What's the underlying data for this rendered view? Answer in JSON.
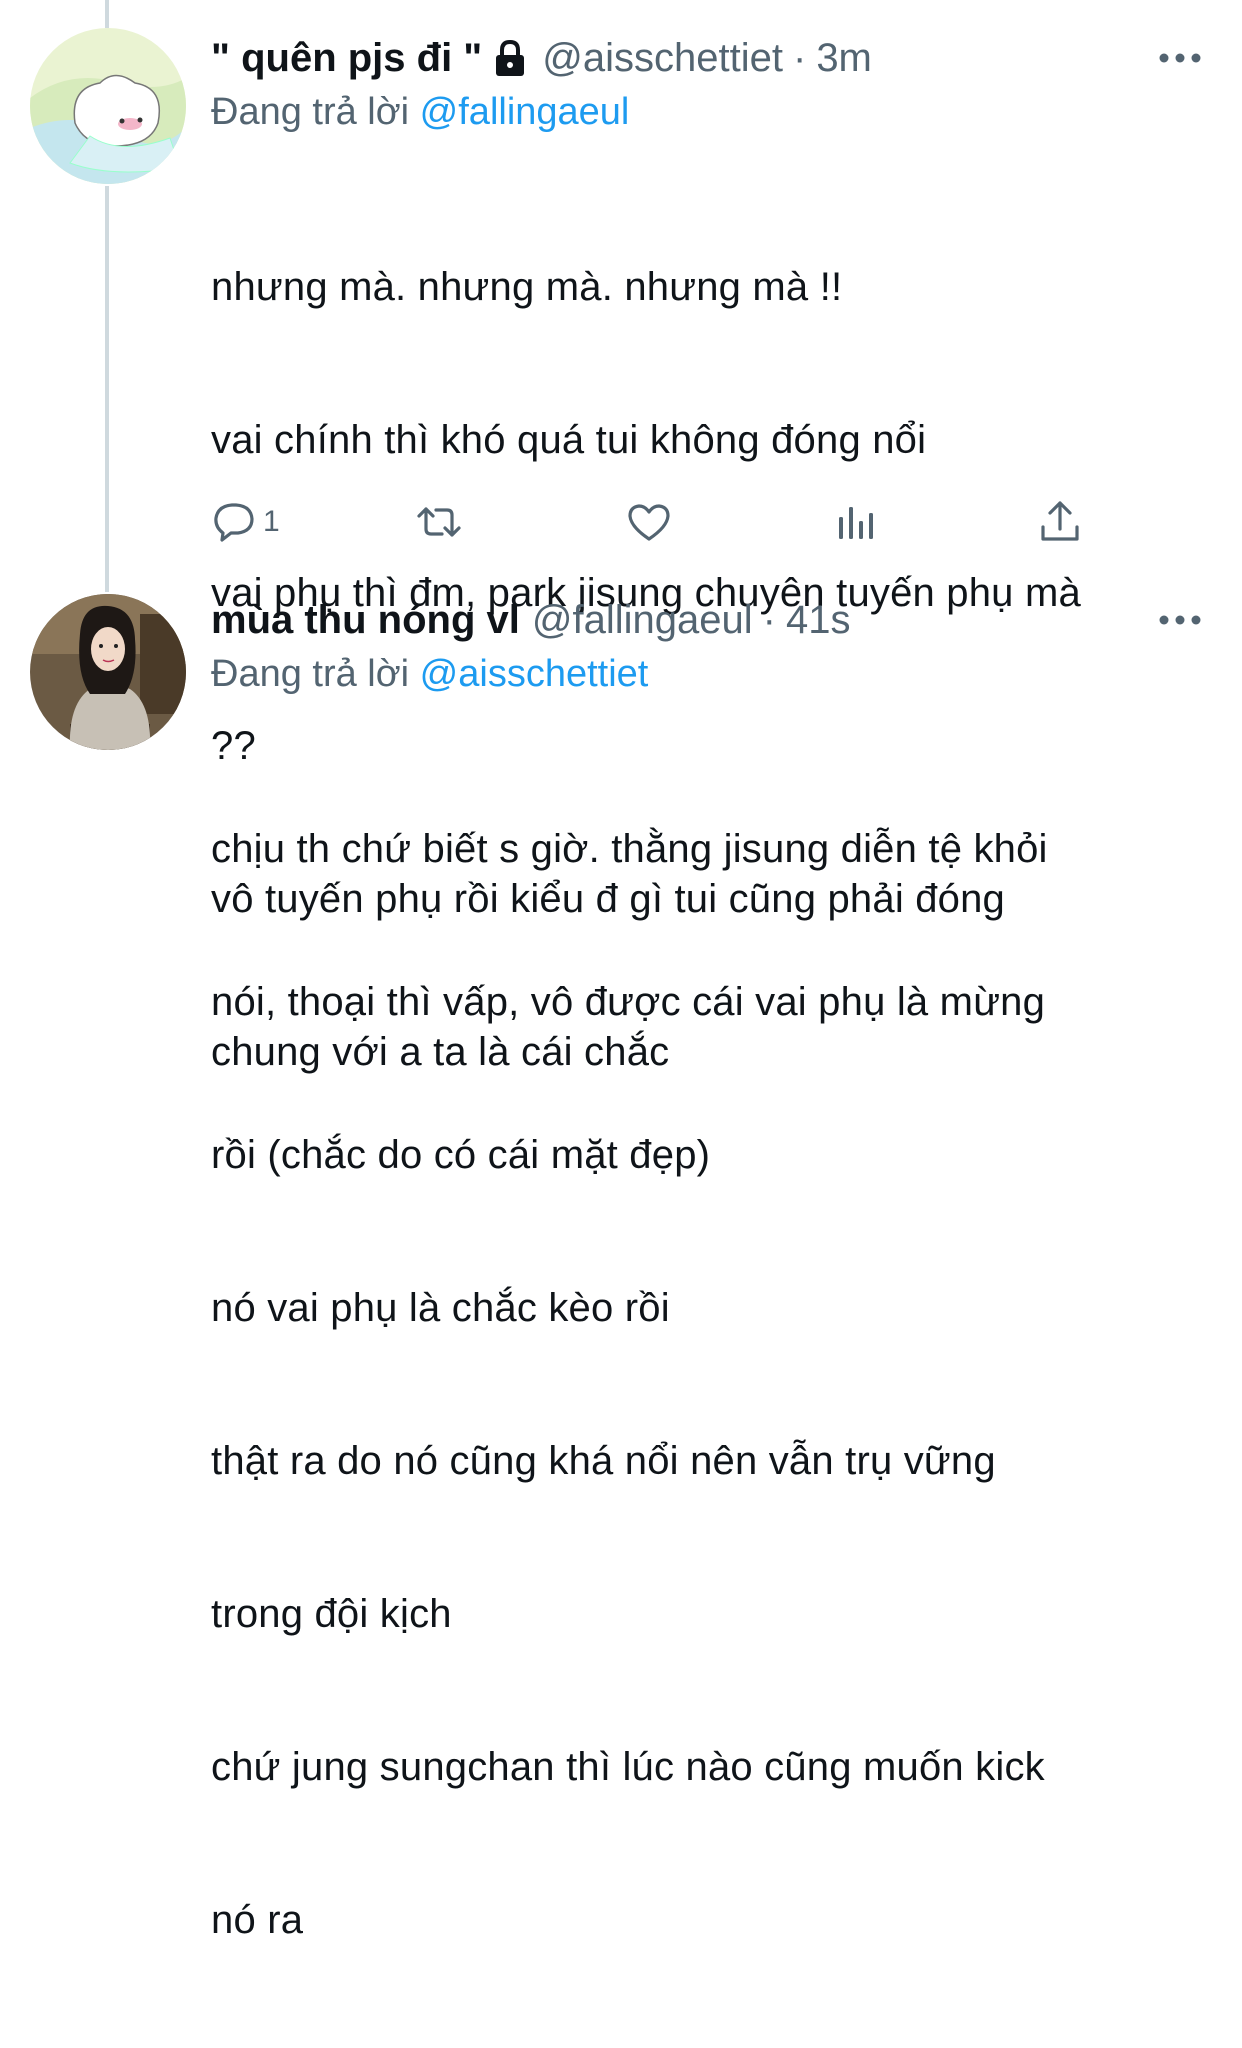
{
  "tweets": [
    {
      "display_name": "\" quên pjs đi \"",
      "handle": "@aisschettiet",
      "separator": "·",
      "time": "3m",
      "replying_prefix": "Đang trả lời",
      "replying_to": "@fallingaeul",
      "text_lines": [
        "nhưng mà. nhưng mà. nhưng mà !!",
        "vai chính thì khó quá tui không đóng nổi",
        "vai phụ thì đm, park jisung chuyên tuyến phụ mà",
        "??",
        "vô tuyến phụ rồi kiểu đ gì tui cũng phải đóng",
        "chung với a ta là cái chắc"
      ],
      "reply_count": "1",
      "icons": [
        "lock-icon",
        "more-icon",
        "reply-icon",
        "retweet-icon",
        "like-icon",
        "stats-icon",
        "share-icon"
      ]
    },
    {
      "display_name": "mùa thu nóng vl",
      "handle": "@fallingaeul",
      "separator": "·",
      "time": "41s",
      "replying_prefix": "Đang trả lời",
      "replying_to": "@aisschettiet",
      "text_lines": [
        "chịu th chứ biết s giờ. thằng jisung diễn tệ khỏi",
        "nói, thoại thì vấp, vô được cái vai phụ là mừng",
        "rồi (chắc do có cái mặt đẹp)",
        "nó vai phụ là chắc kèo rồi",
        "thật ra do nó cũng khá nổi nên vẫn trụ vững",
        "trong đội kịch",
        "chứ jung sungchan thì lúc nào cũng muốn kick",
        "nó ra"
      ]
    }
  ],
  "colors": {
    "text": "#0f1419",
    "secondary": "#536471",
    "link": "#1d9bf0",
    "thread_line": "#cfd9de"
  }
}
